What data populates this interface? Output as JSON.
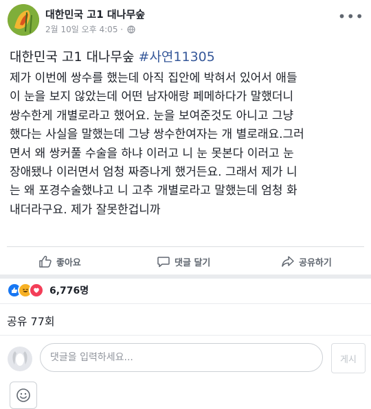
{
  "header": {
    "page_name": "대한민국 고1 대나무숲",
    "timestamp": "2월 10일 오후 4:05 · ",
    "more_label": "•••"
  },
  "post": {
    "title_plain": "대한민국 고1 대나무숲 ",
    "title_hashtag": "#사연11305",
    "body_lines": [
      "제가 이번에 쌍수를 했는데 아직 집안에 박혀서 있어서 애들",
      "이 눈을 보지 않았는데 어떤 남자애랑 페메하다가 말했더니",
      "쌍수한게 개별로라고 했어요. 눈을 보여준것도 아니고 그냥",
      "했다는 사실을 말했는데 그냥 쌍수한여자는 개 별로래요.그러",
      "면서 왜 쌍커풀 수술을 하냐 이러고 니 눈 못본다 이러고 눈",
      "장애됐나 이러면서 엄청 짜증나게 했거든요. 그래서 제가 니",
      "는 왜 포경수술했냐고 니 고추 개별로라고 말했는데 엄청 화",
      "내더라구요. 제가 잘못한겁니까"
    ]
  },
  "actions": {
    "like": "좋아요",
    "comment": "댓글 달기",
    "share": "공유하기"
  },
  "reactions": {
    "count": "6,776명",
    "types": [
      "like",
      "haha",
      "love"
    ]
  },
  "shares": {
    "text": "공유 77회"
  },
  "comment_box": {
    "placeholder": "댓글을 입력하세요...",
    "post_button": "게시"
  },
  "colors": {
    "hashtag": "#365899",
    "like_reaction": "#1877f2",
    "haha_reaction": "#f7b125",
    "love_reaction": "#f33e58"
  }
}
